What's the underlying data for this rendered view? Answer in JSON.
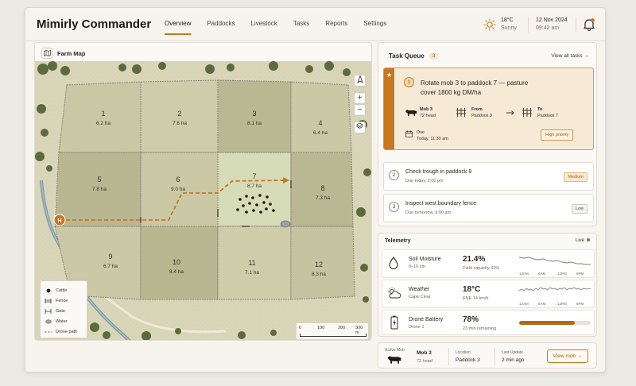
{
  "app": {
    "title": "Mimirly Commander"
  },
  "nav": [
    "Overview",
    "Paddocks",
    "Livestock",
    "Tasks",
    "Reports",
    "Settings"
  ],
  "weather": {
    "temp": "18°C",
    "condition": "Sunny"
  },
  "datetime": {
    "date": "12 Nov 2024",
    "time": "09:42 am"
  },
  "map": {
    "title": "Farm Map",
    "paddocks": [
      {
        "n": "1",
        "area": "6.2 ha"
      },
      {
        "n": "2",
        "area": "7.6 ha"
      },
      {
        "n": "3",
        "area": "8.1 ha"
      },
      {
        "n": "4",
        "area": "6.4 ha"
      },
      {
        "n": "5",
        "area": "7.8 ha"
      },
      {
        "n": "6",
        "area": "9.0 ha"
      },
      {
        "n": "7",
        "area": "8.7 ha"
      },
      {
        "n": "8",
        "area": "7.3 ha"
      },
      {
        "n": "9",
        "area": "6.7 ha"
      },
      {
        "n": "10",
        "area": "8.4 ha"
      },
      {
        "n": "11",
        "area": "7.1 ha"
      },
      {
        "n": "12",
        "area": "8.3 ha"
      }
    ],
    "home_marker": "H",
    "legend": [
      "Cattle",
      "Fence",
      "Gate",
      "Water",
      "Drone path"
    ],
    "scale": [
      "0",
      "100",
      "200",
      "300 m"
    ],
    "controls": {
      "zoom_in": "+",
      "zoom_out": "−"
    }
  },
  "tasks": {
    "title": "Task Queue",
    "count": "3",
    "view_all": "View all tasks →",
    "primary": {
      "num": "1",
      "title": "Rotate mob 3 to paddock 7 — pasture cover 1800 kg DM/ha",
      "mob_label": "Mob 3",
      "mob_head": "72 head",
      "from_label": "From",
      "from_value": "Paddock 3",
      "to_label": "To",
      "to_value": "Paddock 7",
      "due_label": "Due",
      "due_value": "Today, 11:30 am",
      "priority": "High priority"
    },
    "items": [
      {
        "num": "2",
        "title": "Check trough in paddock 8",
        "due": "Due today, 2:00 pm",
        "priority": "Medium"
      },
      {
        "num": "3",
        "title": "Inspect west boundary fence",
        "due": "Due tomorrow, 9:00 am",
        "priority": "Low"
      }
    ]
  },
  "telemetry": {
    "title": "Telemetry",
    "live": "Live",
    "rows": [
      {
        "label": "Soil Moisture",
        "sub": "0–10 cm",
        "value": "21.4%",
        "value_sub": "Field capacity 32%",
        "times": [
          "12AM",
          "6AM",
          "12PM",
          "6PM"
        ]
      },
      {
        "label": "Weather",
        "sub": "Cape Clear",
        "value": "18°C",
        "value_sub": "ENE 14 km/h",
        "times": [
          "12AM",
          "6AM",
          "12PM",
          "6PM"
        ]
      },
      {
        "label": "Drone Battery",
        "sub": "Drone 1",
        "value": "78%",
        "value_sub": "23 min remaining",
        "level": 0.78
      }
    ]
  },
  "active_mob": {
    "label": "Active Mob",
    "name": "Mob 3",
    "head": "72 head",
    "location_label": "Location",
    "location": "Paddock 3",
    "update_label": "Last Update",
    "update": "2 min ago",
    "button": "View mob →"
  },
  "colors": {
    "accent": "#c8771f",
    "background": "#f7f4ee",
    "live": "#5b8b4b"
  }
}
